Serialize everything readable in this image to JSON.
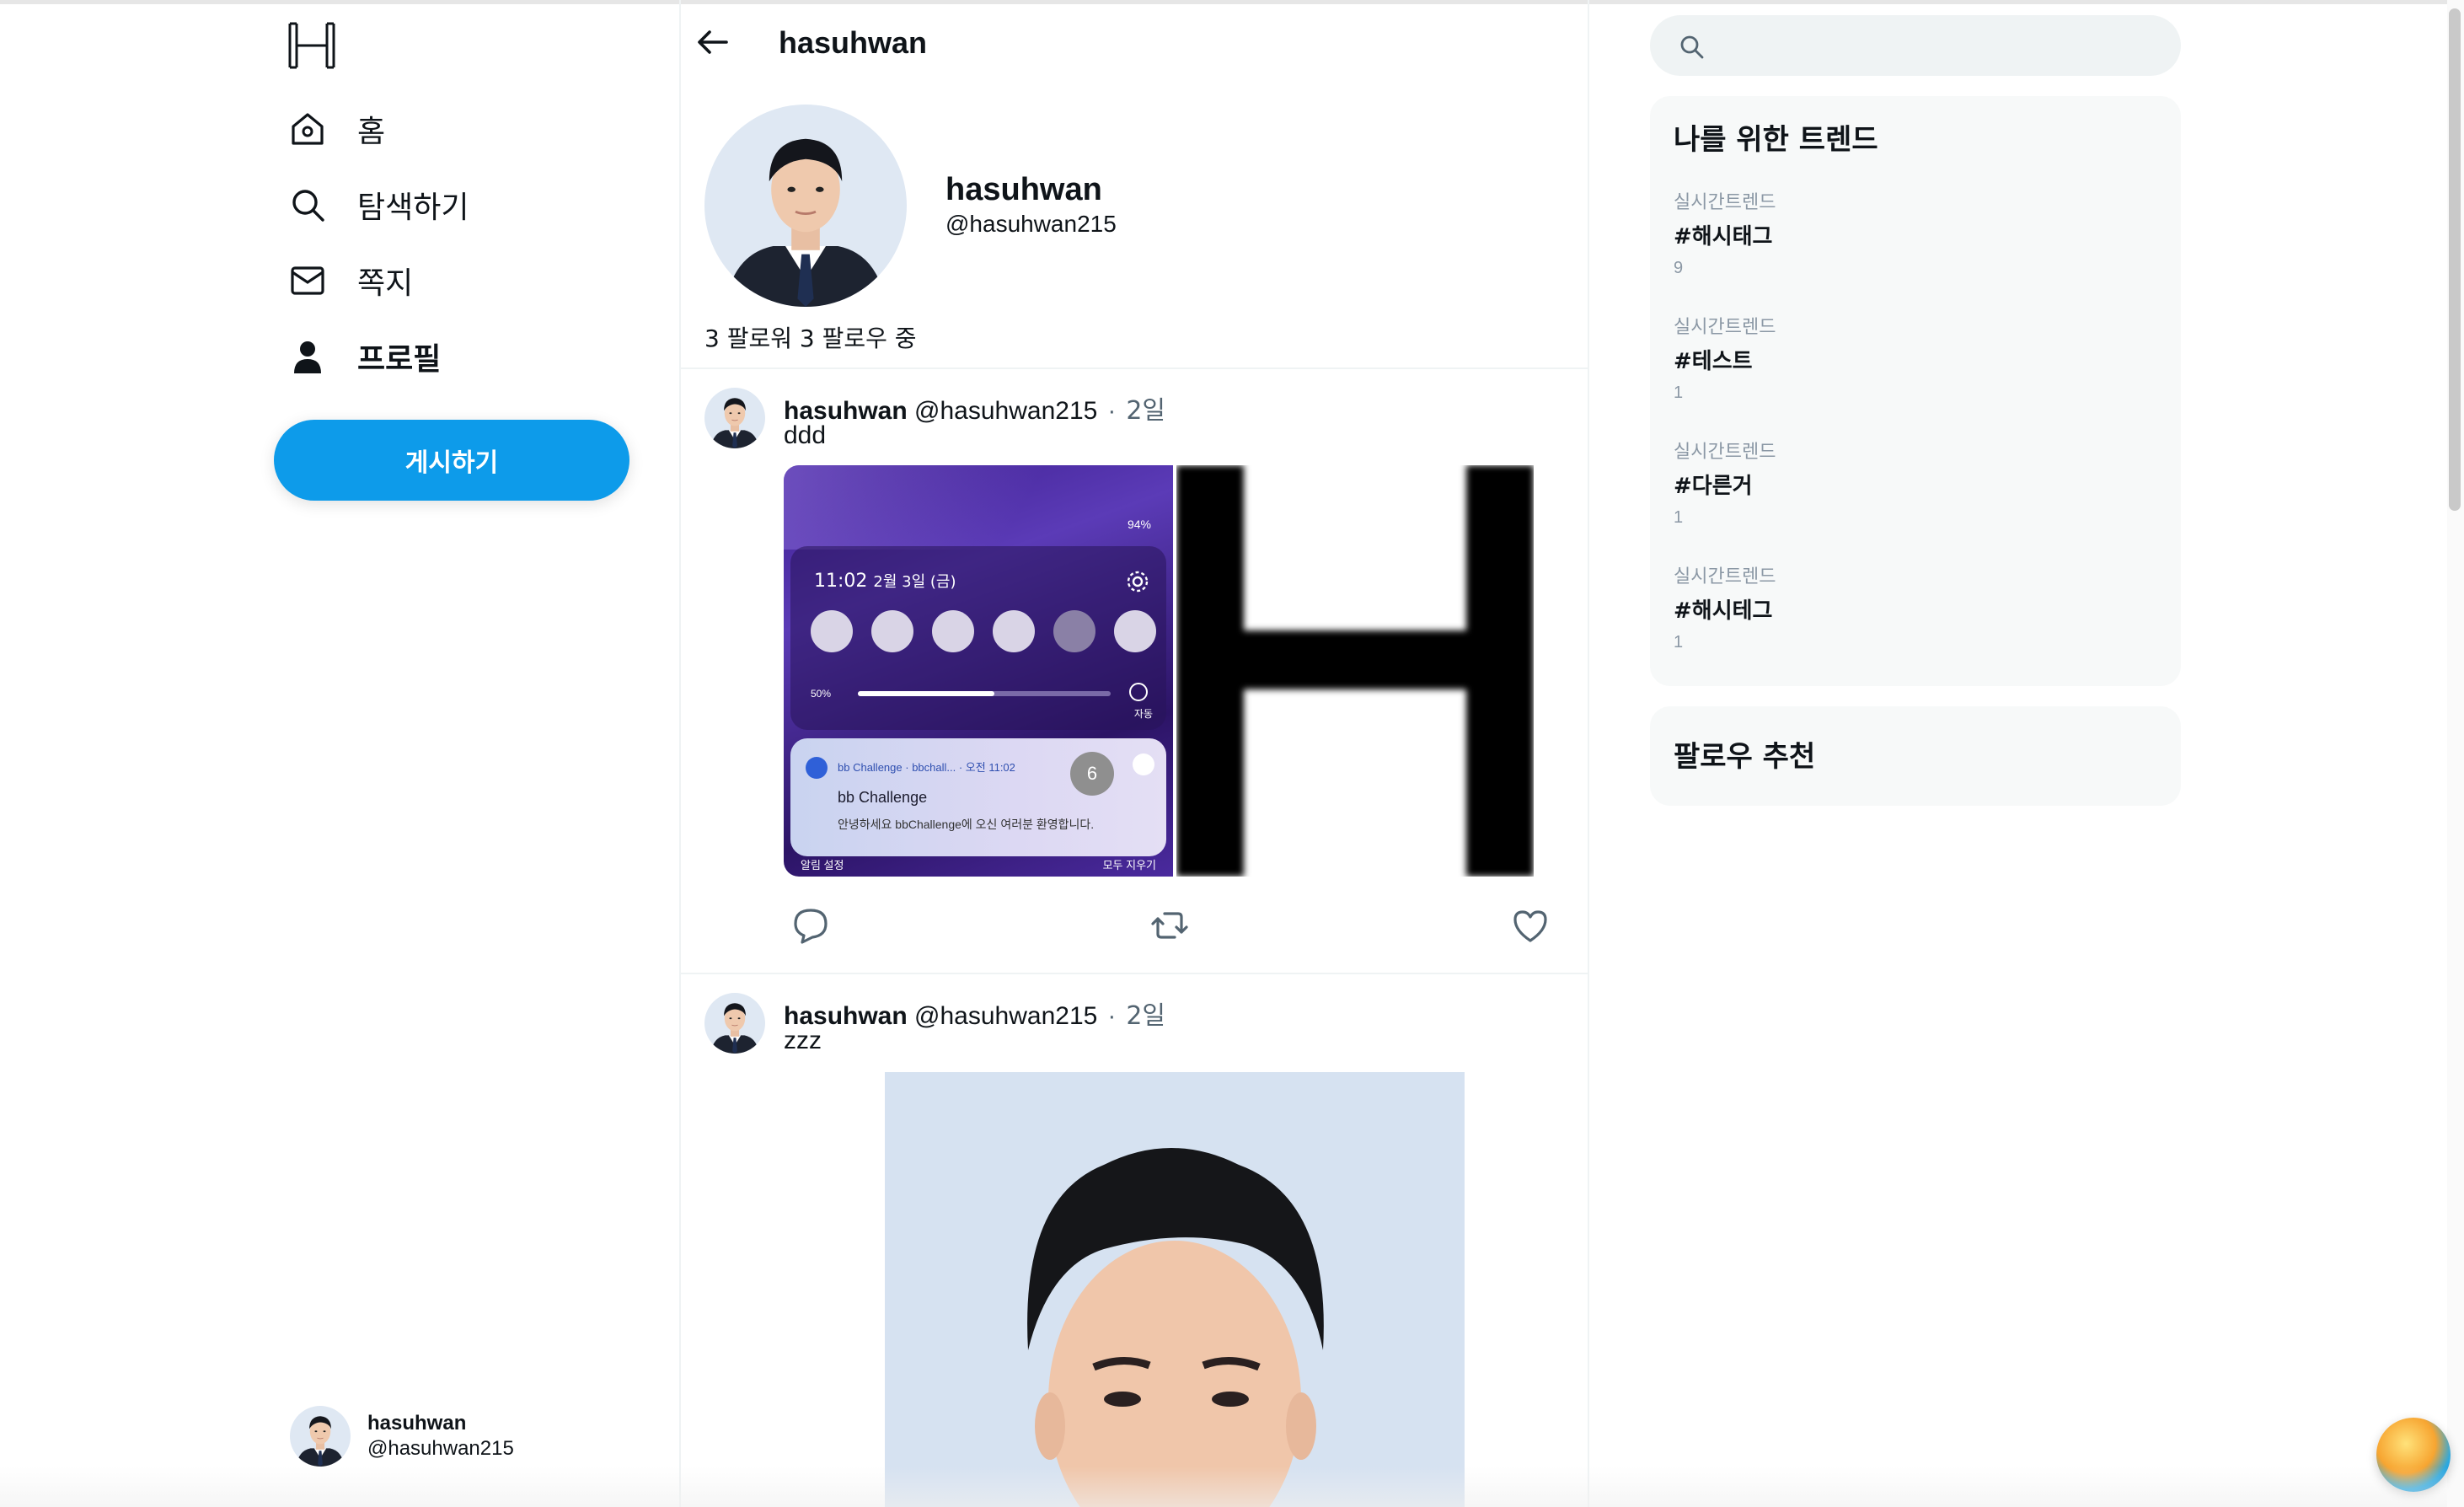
{
  "app": {
    "logo_letter": "H"
  },
  "sidebar": {
    "items": [
      {
        "label": "홈",
        "icon": "home-icon",
        "active": false
      },
      {
        "label": "탐색하기",
        "icon": "search-icon",
        "active": false
      },
      {
        "label": "쪽지",
        "icon": "mail-icon",
        "active": false
      },
      {
        "label": "프로필",
        "icon": "person-icon",
        "active": true
      }
    ],
    "post_button": "게시하기",
    "account": {
      "name": "hasuhwan",
      "handle": "@hasuhwan215"
    }
  },
  "header": {
    "title": "hasuhwan"
  },
  "profile": {
    "name": "hasuhwan",
    "handle": "@hasuhwan215",
    "follow_text": "3 팔로워 3 팔로우 중"
  },
  "posts": [
    {
      "name": "hasuhwan",
      "handle": "@hasuhwan215",
      "dot": "·",
      "time": "2일",
      "text": "ddd",
      "screenshot": {
        "time": "11:02",
        "date": "2월 3일 (금)",
        "status": "94%",
        "brightness": "50%",
        "auto": "자동",
        "app": "bb Challenge",
        "app_sub": "bbchall...",
        "notif_time": "오전 11:02",
        "notif_title": "bb Challenge",
        "notif_body": "안녕하세요 bbChallenge에 오신 여러분 환영합니다.",
        "badge": "6",
        "footer_left": "알림 설정",
        "footer_right": "모두 지우기"
      },
      "logo_image_letter": "H"
    },
    {
      "name": "hasuhwan",
      "handle": "@hasuhwan215",
      "dot": "·",
      "time": "2일",
      "text": "zzz"
    }
  ],
  "search": {
    "placeholder": ""
  },
  "trends": {
    "title": "나를 위한 트렌드",
    "items": [
      {
        "category": "실시간트렌드",
        "tag": "#해시태그",
        "count": "9"
      },
      {
        "category": "실시간트렌드",
        "tag": "#테스트",
        "count": "1"
      },
      {
        "category": "실시간트렌드",
        "tag": "#다른거",
        "count": "1"
      },
      {
        "category": "실시간트렌드",
        "tag": "#해시테그",
        "count": "1"
      }
    ]
  },
  "follow_suggest": {
    "title": "팔로우 추천"
  },
  "colors": {
    "accent": "#0d9bea",
    "panel": "#f7f9f9",
    "text": "#0f1419",
    "muted": "#536471"
  }
}
